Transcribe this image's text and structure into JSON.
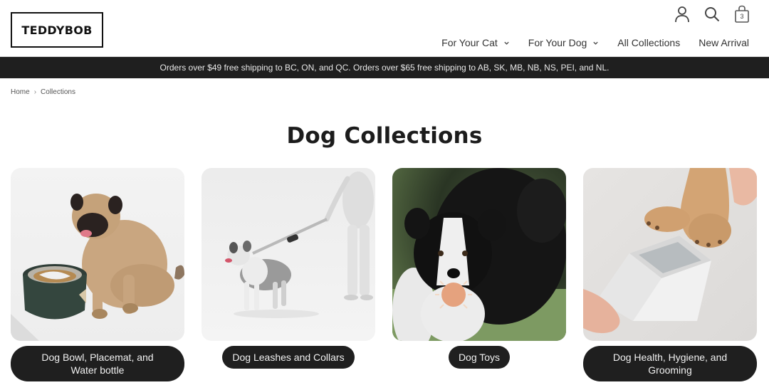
{
  "brand": {
    "logo_text": "TEDDYBOB"
  },
  "header": {
    "icons": [
      {
        "name": "account-icon"
      },
      {
        "name": "search-icon"
      },
      {
        "name": "cart-icon",
        "count": "3"
      }
    ],
    "nav": [
      {
        "label": "For Your Cat",
        "has_dropdown": true
      },
      {
        "label": "For Your Dog",
        "has_dropdown": true
      },
      {
        "label": "All Collections",
        "has_dropdown": false
      },
      {
        "label": "New Arrival",
        "has_dropdown": false
      }
    ]
  },
  "announcement": "Orders over $49 free shipping to BC, ON, and QC. Orders over $65 free shipping to AB, SK, MB, NB, NS, PEI, and NL.",
  "breadcrumb": {
    "items": [
      "Home",
      "Collections"
    ],
    "separator": "›"
  },
  "page": {
    "title": "Dog Collections"
  },
  "collections": [
    {
      "label": "Dog Bowl, Placemat, and Water bottle",
      "image": "pug with slow-feeder bowl"
    },
    {
      "label": "Dog Leashes and Collars",
      "image": "merle dog on leash held by mannequin"
    },
    {
      "label": "Dog Toys",
      "image": "border collie holding spiky ball"
    },
    {
      "label": "Dog Health, Hygiene, and Grooming",
      "image": "dog paw in paw cleaner cup"
    }
  ],
  "colors": {
    "dark": "#1f1f1f",
    "text": "#222222",
    "background": "#ffffff"
  }
}
